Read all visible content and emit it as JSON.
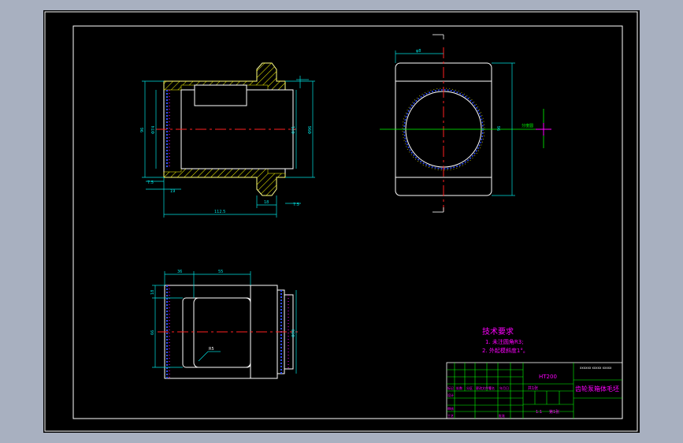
{
  "colors": {
    "background": "#a8b0c0",
    "viewport": "#000000",
    "outline": "#ffffff",
    "dimension": "#00e0e0",
    "centerline": "#ff2020",
    "hatch": "#ffff00",
    "notes": "#ff00ff",
    "titleblock_grid": "#00ff00",
    "thread": "#3050ff",
    "axis": "#00ff00"
  },
  "front_view": {
    "dim_outer_left": "96",
    "dim_inner_left": "Φ74",
    "dim_inner_right": "Φ71",
    "dim_outer_right": "Φ96",
    "dim_step_left": "7.5",
    "dim_step": "19",
    "dim_total_length": "112.5",
    "dim_flange": "18",
    "dim_step_right": "7.5"
  },
  "side_view": {
    "dim_top": "φ8",
    "dim_height": "96",
    "axis_label": "分度圆"
  },
  "bottom_view": {
    "dim_a": "36",
    "dim_b": "55",
    "dim_left_top": "18",
    "dim_left_main": "66",
    "dim_right": "Φ90",
    "radius_label": "R5"
  },
  "notes": {
    "title": "技术要求",
    "line1": "1. 未注圆角R3;",
    "line2": "2. 外起模斜度1°。"
  },
  "title_block": {
    "material": "HT200",
    "part_name": "齿轮泵箱体毛坯",
    "school_code": "xxxxxx xxxxx xxxxx",
    "scale_label": "1:1",
    "sheet_label": "第1张",
    "sheets_total": "共1张",
    "row_labels": [
      "标记",
      "处数",
      "分区",
      "更改文件号",
      "签名",
      "年月日"
    ],
    "side_labels": [
      "设计",
      "审核",
      "工艺",
      "批准"
    ]
  }
}
